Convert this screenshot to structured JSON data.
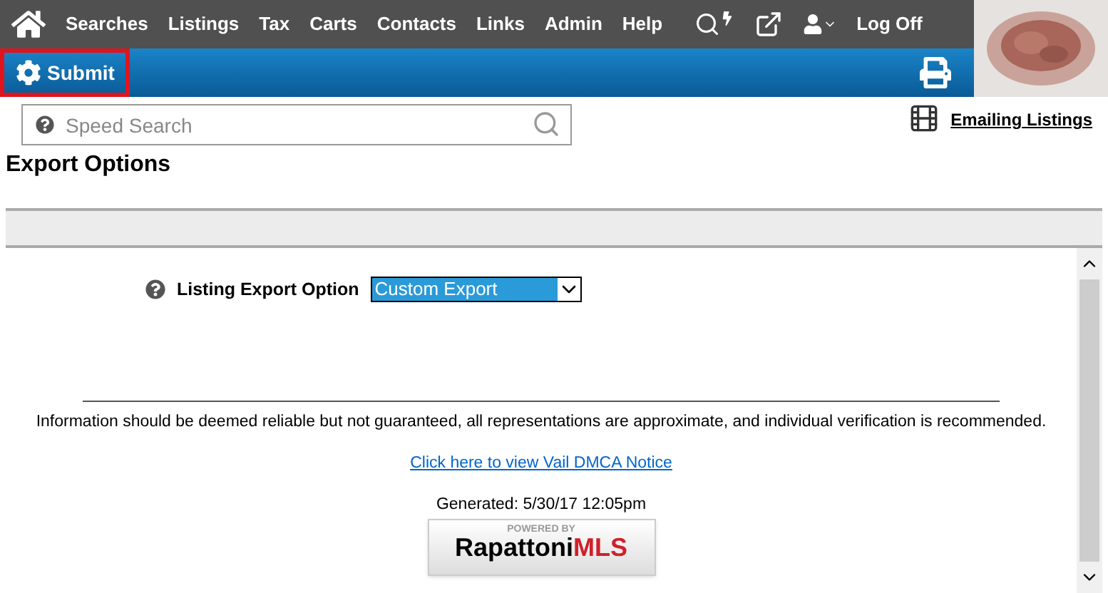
{
  "nav": {
    "items": [
      {
        "label": "Searches"
      },
      {
        "label": "Listings"
      },
      {
        "label": "Tax"
      },
      {
        "label": "Carts"
      },
      {
        "label": "Contacts"
      },
      {
        "label": "Links"
      },
      {
        "label": "Admin"
      },
      {
        "label": "Help"
      }
    ],
    "logoff": "Log Off"
  },
  "toolbar": {
    "submit": "Submit",
    "submit_highlighted": true
  },
  "search": {
    "placeholder": "Speed Search"
  },
  "emailing_link": "Emailing Listings",
  "page_title": "Export Options",
  "form": {
    "label": "Listing Export Option",
    "value": "Custom Export"
  },
  "footer": {
    "disclaimer": "Information should be deemed reliable but not guaranteed, all representations are approximate, and individual verification is recommended.",
    "dmca_link": "Click here to view Vail DMCA Notice",
    "generated": "Generated: 5/30/17 12:05pm",
    "logo_top": "POWERED BY",
    "logo_main": "Rapattoni",
    "logo_accent": "MLS"
  }
}
